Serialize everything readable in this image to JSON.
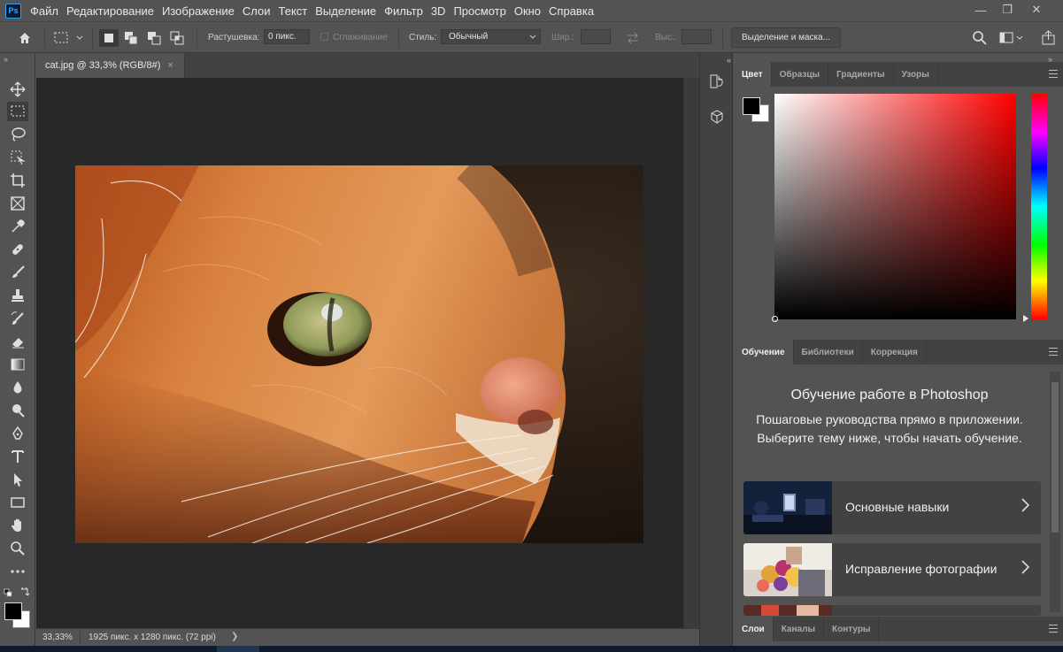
{
  "app": {
    "logo_text": "Ps"
  },
  "menu": [
    "Файл",
    "Редактирование",
    "Изображение",
    "Слои",
    "Текст",
    "Выделение",
    "Фильтр",
    "3D",
    "Просмотр",
    "Окно",
    "Справка"
  ],
  "window_controls": {
    "minimize": "—",
    "restore": "❐",
    "close": "✕"
  },
  "options": {
    "feather_label": "Растушевка:",
    "feather_value": "0 пикс.",
    "antialias_label": "Сглаживание",
    "style_label": "Стиль:",
    "style_value": "Обычный",
    "width_label": "Шир.:",
    "height_label": "Выс.:",
    "mask_button": "Выделение и маска..."
  },
  "document": {
    "tab_title": "cat.jpg @ 33,3% (RGB/8#)",
    "tab_close": "×",
    "zoom": "33,33%",
    "info": "1925 пикс. x 1280 пикс. (72 ppi)",
    "info_arrow": "❯"
  },
  "color_panel": {
    "tabs": [
      "Цвет",
      "Образцы",
      "Градиенты",
      "Узоры"
    ],
    "foreground": "#000000",
    "background": "#ffffff",
    "hue": "#ff0000"
  },
  "learn_panel": {
    "tabs": [
      "Обучение",
      "Библиотеки",
      "Коррекция"
    ],
    "title": "Обучение работе в Photoshop",
    "description": "Пошаговые руководства прямо в приложении. Выберите тему ниже, чтобы начать обучение.",
    "cards": [
      {
        "label": "Основные навыки"
      },
      {
        "label": "Исправление фотографии"
      },
      {
        "label": ""
      }
    ]
  },
  "layers_panel": {
    "tabs": [
      "Слои",
      "Каналы",
      "Контуры"
    ]
  }
}
